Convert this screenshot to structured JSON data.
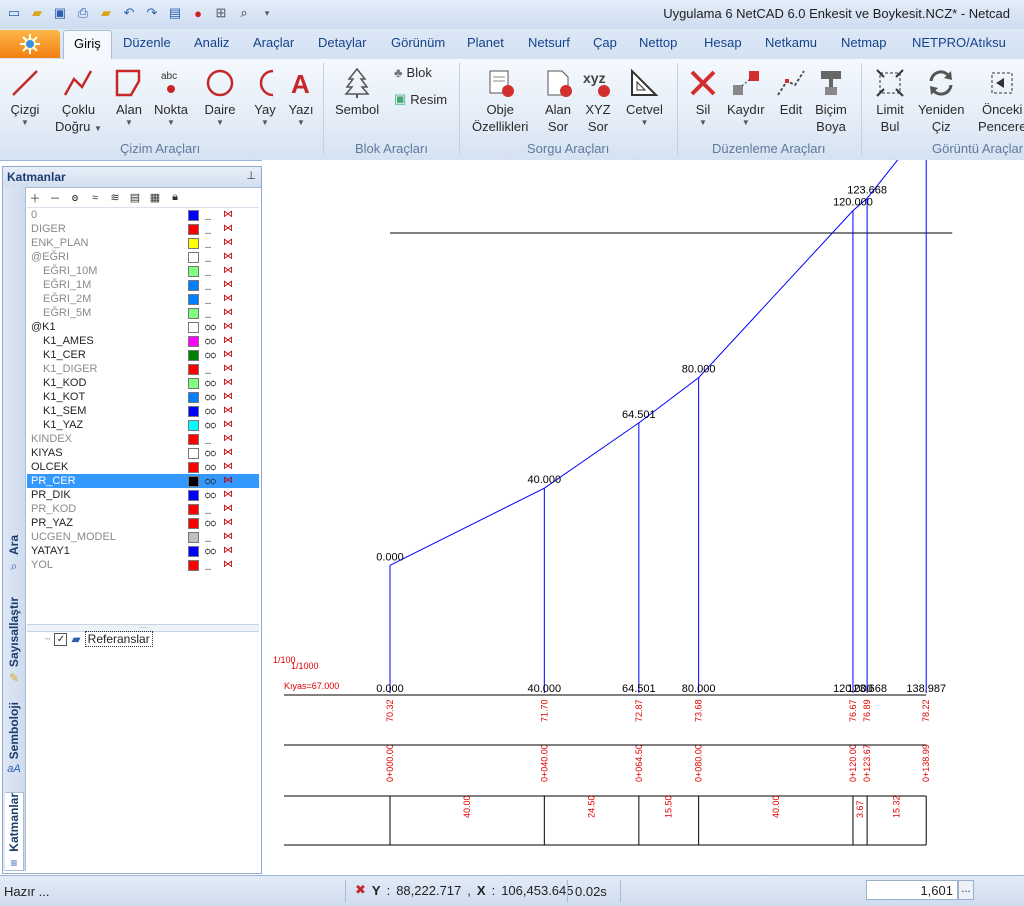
{
  "window": {
    "title": "Uygulama 6 NetCAD 6.0 Enkesit ve Boykesit.NCZ* - Netcad"
  },
  "quick_access": [
    "new-icon",
    "open-icon",
    "save-icon",
    "print-icon",
    "folder-icon",
    "undo-icon",
    "redo-icon",
    "toolbar-icon",
    "info-icon",
    "grid-icon",
    "zoom-icon",
    "customize-icon"
  ],
  "tabs": [
    "Giriş",
    "Düzenle",
    "Analiz",
    "Araçlar",
    "Detaylar",
    "Görünüm",
    "Planet",
    "Netsurf",
    "Çap",
    "Nettop",
    "Hesap",
    "Netkamu",
    "Netmap",
    "NETPRO/Atıksu"
  ],
  "active_tab": "Giriş",
  "ribbon": {
    "groups": {
      "cizim": "Çizim Araçları",
      "blok": "Blok Araçları",
      "sorgu": "Sorgu Araçları",
      "duzenleme": "Düzenleme Araçları",
      "goruntu": "Görüntü Araçları"
    },
    "buttons": {
      "cizgi": [
        "Çizgi",
        ""
      ],
      "coklu": [
        "Çoklu",
        "Doğru"
      ],
      "alan": [
        "Alan",
        ""
      ],
      "nokta": [
        "Nokta",
        ""
      ],
      "daire": [
        "Daire",
        ""
      ],
      "yay": [
        "Yay",
        ""
      ],
      "yazi": [
        "Yazı",
        ""
      ],
      "sembol": [
        "Sembol",
        ""
      ],
      "blok": "Blok",
      "resim": "Resim",
      "obje": [
        "Obje",
        "Özellikleri"
      ],
      "alansor": [
        "Alan",
        "Sor"
      ],
      "xyzsor": [
        "XYZ",
        "Sor"
      ],
      "cetvel": [
        "Cetvel",
        ""
      ],
      "sil": [
        "Sil",
        ""
      ],
      "kaydir": [
        "Kaydır",
        ""
      ],
      "edit": [
        "Edit",
        ""
      ],
      "bicim": [
        "Biçim",
        "Boya"
      ],
      "limit": [
        "Limit",
        "Bul"
      ],
      "yeniden": [
        "Yeniden",
        "Çiz"
      ],
      "onceki": [
        "Önceki",
        "Pencere"
      ]
    },
    "icon_text": {
      "abc": "abc",
      "xyz": "xyz",
      "A": "A"
    }
  },
  "layers_panel": {
    "title": "Katmanlar",
    "side_tabs": [
      "Ara",
      "Sayısallaştır",
      "Semboloji",
      "Katmanlar"
    ],
    "layers": [
      {
        "name": "0",
        "color": "#0000ff",
        "dim": true,
        "indent": false
      },
      {
        "name": "DIGER",
        "color": "#ff0000",
        "dim": true,
        "indent": false
      },
      {
        "name": "ENK_PLAN",
        "color": "#ffff00",
        "dim": true,
        "indent": false
      },
      {
        "name": "@EĞRI",
        "color": "#ffffff",
        "dim": true,
        "indent": false
      },
      {
        "name": "EĞRI_10M",
        "color": "#80ff80",
        "dim": true,
        "indent": true
      },
      {
        "name": "EĞRI_1M",
        "color": "#0080ff",
        "dim": true,
        "indent": true
      },
      {
        "name": "EĞRI_2M",
        "color": "#0080ff",
        "dim": true,
        "indent": true
      },
      {
        "name": "EĞRI_5M",
        "color": "#80ff80",
        "dim": true,
        "indent": true
      },
      {
        "name": "@K1",
        "color": "#ffffff",
        "dim": false,
        "indent": false
      },
      {
        "name": "K1_AMES",
        "color": "#ff00ff",
        "dim": false,
        "indent": true
      },
      {
        "name": "K1_CER",
        "color": "#008000",
        "dim": false,
        "indent": true
      },
      {
        "name": "K1_DIGER",
        "color": "#ff0000",
        "dim": true,
        "indent": true
      },
      {
        "name": "K1_KOD",
        "color": "#80ff80",
        "dim": false,
        "indent": true
      },
      {
        "name": "K1_KOT",
        "color": "#0080ff",
        "dim": false,
        "indent": true
      },
      {
        "name": "K1_SEM",
        "color": "#0000ff",
        "dim": false,
        "indent": true
      },
      {
        "name": "K1_YAZ",
        "color": "#00ffff",
        "dim": false,
        "indent": true
      },
      {
        "name": "KINDEX",
        "color": "#ff0000",
        "dim": true,
        "indent": false
      },
      {
        "name": "KIYAS",
        "color": "#ffffff",
        "dim": false,
        "indent": false
      },
      {
        "name": "OLCEK",
        "color": "#ff0000",
        "dim": false,
        "indent": false
      },
      {
        "name": "PR_CER",
        "color": "#000000",
        "dim": false,
        "indent": false,
        "selected": true
      },
      {
        "name": "PR_DIK",
        "color": "#0000ff",
        "dim": false,
        "indent": false
      },
      {
        "name": "PR_KOD",
        "color": "#ff0000",
        "dim": true,
        "indent": false
      },
      {
        "name": "PR_YAZ",
        "color": "#ff0000",
        "dim": false,
        "indent": false
      },
      {
        "name": "UCGEN_MODEL",
        "color": "#c0c0c0",
        "dim": true,
        "indent": false
      },
      {
        "name": "YATAY1",
        "color": "#0000ff",
        "dim": false,
        "indent": false
      },
      {
        "name": "YOL",
        "color": "#ff0000",
        "dim": true,
        "indent": false
      }
    ],
    "references_label": "Referanslar"
  },
  "profile": {
    "stations": [
      {
        "label": "0.000",
        "km": "0+000.00",
        "elev": "70.32"
      },
      {
        "label": "40.000",
        "km": "0+040.00",
        "elev": "71.70"
      },
      {
        "label": "64.501",
        "km": "0+064.50",
        "elev": "72.87"
      },
      {
        "label": "80.000",
        "km": "0+080.00",
        "elev": "73.68"
      },
      {
        "label": "120.000",
        "km": "0+120.00",
        "elev": "76.67"
      },
      {
        "label": "123.668",
        "km": "0+123.67",
        "elev": "76.89"
      },
      {
        "label": "138.987",
        "km": "0+138.99",
        "elev": "78.22"
      }
    ],
    "segments": [
      "40.00",
      "24.50",
      "15.50",
      "40.00",
      "3.67",
      "15.32"
    ],
    "scale_h": "1/100",
    "scale_v": "1/1000",
    "kiyas": "Kıyas=67.000"
  },
  "status": {
    "ready": "Hazır ...",
    "y_label": "Y",
    "y_value": "88,222.717",
    "x_label": "X",
    "x_value": "106,453.645",
    "time": "0.02s",
    "scale": "1,601",
    "scale_btn": "..."
  }
}
